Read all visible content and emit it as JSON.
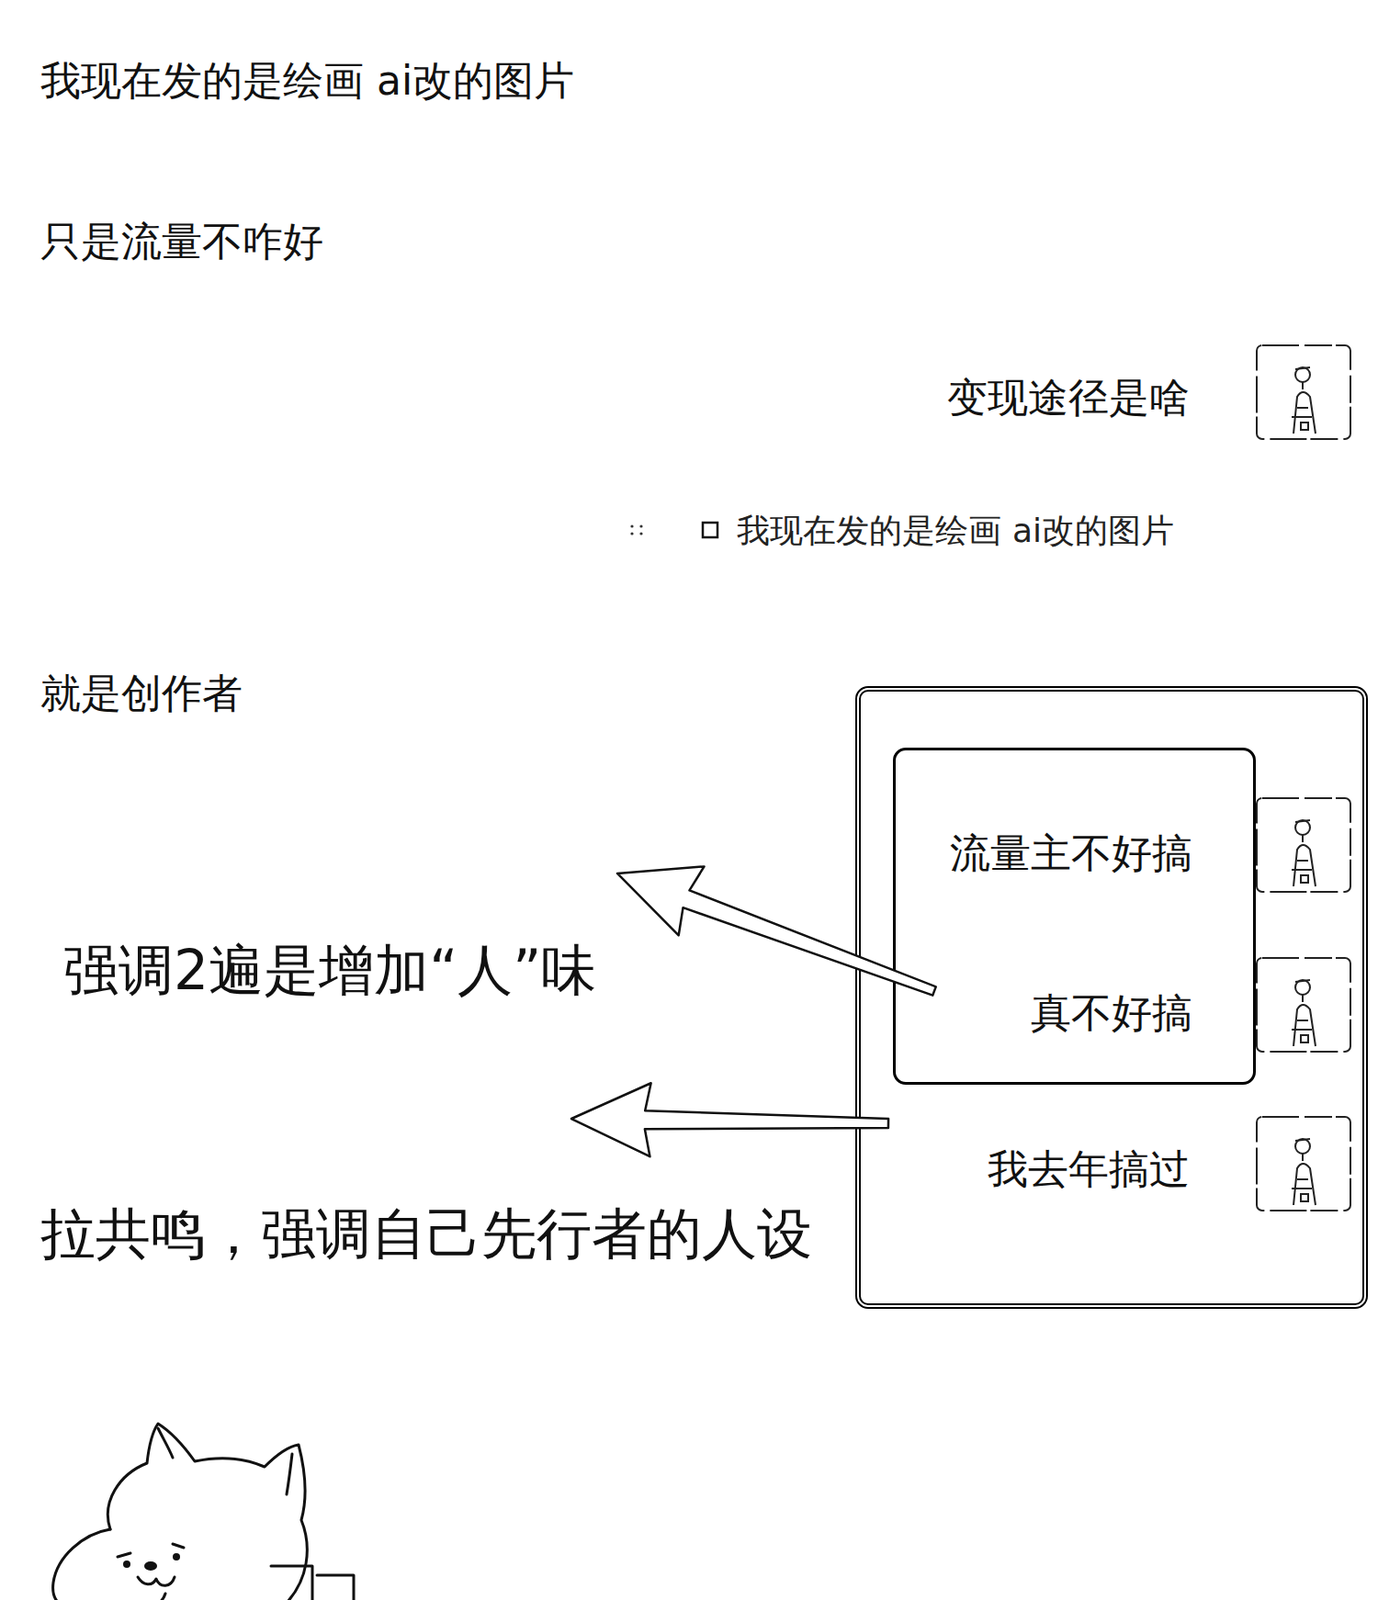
{
  "opening_messages": [
    {
      "text": "我现在发的是绘画 ai改的图片"
    },
    {
      "text": "只是流量不咋好"
    }
  ],
  "question": {
    "text": "变现途径是啥"
  },
  "quote": {
    "text": "我现在发的是绘画 ai改的图片"
  },
  "reply": {
    "text": "就是创作者"
  },
  "highlighted_messages": [
    {
      "text": "流量主不好搞"
    },
    {
      "text": "真不好搞"
    }
  ],
  "last_message": {
    "text": "我去年搞过"
  },
  "annotations": [
    {
      "text": "强调2遍是增加“人”味"
    },
    {
      "text": "拉共鸣，强调自己先行者的人设"
    }
  ]
}
